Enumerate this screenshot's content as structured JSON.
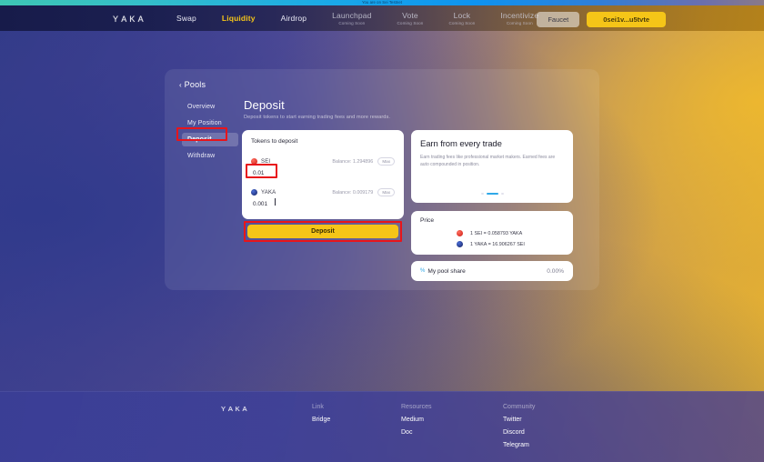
{
  "announcement": {
    "text": "You are on Sei Testnet"
  },
  "header": {
    "logo_letters": [
      "Y",
      "A",
      "K",
      "A"
    ],
    "nav": [
      {
        "label": "Swap",
        "sub": "",
        "state": "default"
      },
      {
        "label": "Liquidity",
        "sub": "",
        "state": "active"
      },
      {
        "label": "Airdrop",
        "sub": "",
        "state": "default"
      },
      {
        "label": "Launchpad",
        "sub": "Coming Soon",
        "state": "soon"
      },
      {
        "label": "Vote",
        "sub": "Coming Soon",
        "state": "soon"
      },
      {
        "label": "Lock",
        "sub": "Coming Soon",
        "state": "soon"
      },
      {
        "label": "Incentivize",
        "sub": "Coming Soon",
        "state": "soon"
      }
    ],
    "faucet_label": "Faucet",
    "wallet_label": "0sei1v...u5tvte"
  },
  "breadcrumb": {
    "chevron": "‹",
    "label": "Pools"
  },
  "sidebar": {
    "items": [
      {
        "label": "Overview",
        "active": false
      },
      {
        "label": "My Position",
        "active": false
      },
      {
        "label": "Deposit",
        "active": true
      },
      {
        "label": "Withdraw",
        "active": false
      }
    ]
  },
  "section": {
    "title": "Deposit",
    "subtitle": "Deposit tokens to start earning trading fees and more rewards."
  },
  "deposit_card": {
    "title": "Tokens to deposit",
    "max_label": "Max",
    "tokens": [
      {
        "symbol": "SEI",
        "balance_label": "Balance: 1.294896",
        "amount": "0.01",
        "placeholder": "0.0"
      },
      {
        "symbol": "YAKA",
        "balance_label": "Balance: 0.009179",
        "amount": "0.001",
        "placeholder": "0.0"
      }
    ],
    "submit_label": "Deposit"
  },
  "earn_card": {
    "title": "Earn from every trade",
    "description": "Earn trading fees like professional market makers. Earned fees are auto compounded in position.",
    "slides": 3,
    "active_slide": 1
  },
  "price_card": {
    "title": "Price",
    "rows": [
      {
        "text": "1 SEI = 0.058793 YAKA",
        "token": "sei"
      },
      {
        "text": "1 YAKA = 16.906267 SEI",
        "token": "yaka"
      }
    ]
  },
  "pool_share": {
    "icon": "%",
    "label": "My pool share",
    "value": "0.00%"
  },
  "footer": {
    "logo_letters": [
      "Y",
      "A",
      "K",
      "A"
    ],
    "columns": [
      {
        "heading": "Link",
        "links": [
          "Bridge"
        ]
      },
      {
        "heading": "Resources",
        "links": [
          "Medium",
          "Doc"
        ]
      },
      {
        "heading": "Community",
        "links": [
          "Twitter",
          "Discord",
          "Telegram"
        ]
      }
    ]
  },
  "annotations": {
    "colors": {
      "box": "#e8151b",
      "accent": "#f5c518",
      "link": "#2fa8e8"
    }
  }
}
